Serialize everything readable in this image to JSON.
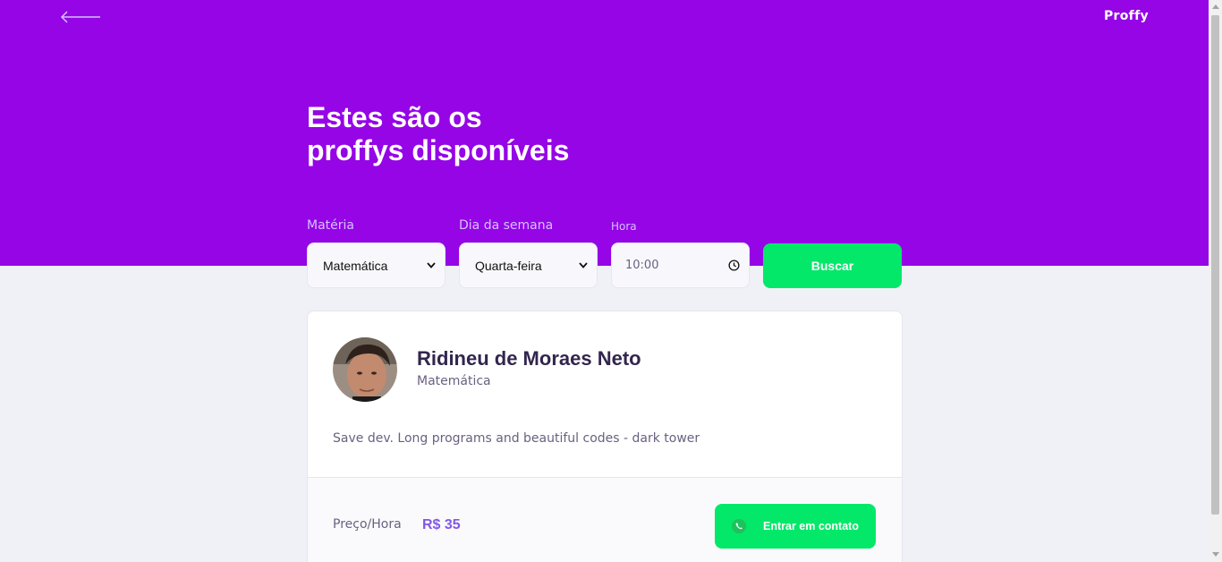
{
  "header": {
    "logo": "Proffy",
    "title_line1": "Estes são os",
    "title_line2": "proffys disponíveis",
    "back_icon": "arrow-left-icon"
  },
  "filters": {
    "subject_label": "Matéria",
    "subject_value": "Matemática",
    "weekday_label": "Dia da semana",
    "weekday_value": "Quarta-feira",
    "time_label": "Hora",
    "time_value": "10:00",
    "search_label": "Buscar"
  },
  "teacher": {
    "name": "Ridineu de Moraes Neto",
    "subject": "Matemática",
    "bio": "Save dev. Long programs and beautiful codes - dark tower",
    "price_label": "Preço/Hora",
    "price_value": "R$ 35",
    "contact_label": "Entrar em contato",
    "contact_icon": "whatsapp-icon"
  },
  "colors": {
    "primary": "#9505e6",
    "accent_green": "#04e86a",
    "background": "#f0f0f7",
    "price": "#8257e5"
  }
}
